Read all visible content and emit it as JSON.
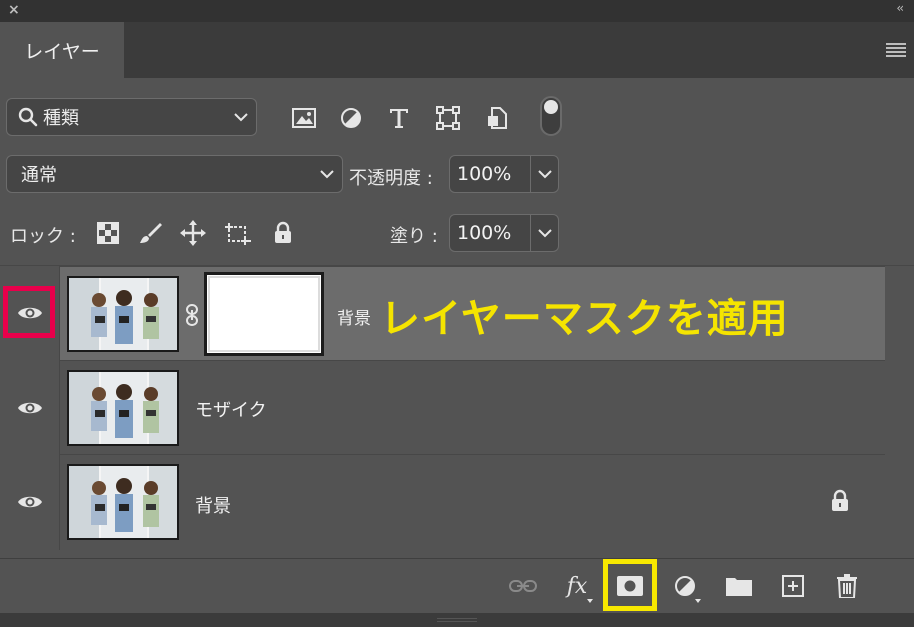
{
  "panel": {
    "close_glyph": "×",
    "collapse_glyph": "‹‹",
    "tab_label": "レイヤー"
  },
  "filter": {
    "kind_label": "種類",
    "icons": [
      "image-filter-icon",
      "adjustment-filter-icon",
      "type-filter-icon",
      "shape-filter-icon",
      "smart-object-filter-icon"
    ]
  },
  "blend": {
    "mode": "通常",
    "opacity_label": "不透明度 :",
    "opacity_value": "100%"
  },
  "lock": {
    "label": "ロック :",
    "fill_label": "塗り :",
    "fill_value": "100%"
  },
  "layers": [
    {
      "name": "背景",
      "selected": true,
      "has_mask": true,
      "locked": false
    },
    {
      "name": "モザイク",
      "selected": false,
      "has_mask": false,
      "locked": false
    },
    {
      "name": "背景",
      "selected": false,
      "has_mask": false,
      "locked": true
    }
  ],
  "annotation": {
    "text": "レイヤーマスクを適用",
    "color": "#f5e400"
  },
  "highlights": {
    "eye_box_color": "#e8004b",
    "mask_button_box_color": "#f7e800"
  },
  "footer": {
    "fx_label": "fx",
    "icons": [
      "link-layers-icon",
      "fx-icon",
      "add-mask-icon",
      "adjustment-layer-icon",
      "new-group-icon",
      "new-layer-icon",
      "delete-icon"
    ]
  }
}
